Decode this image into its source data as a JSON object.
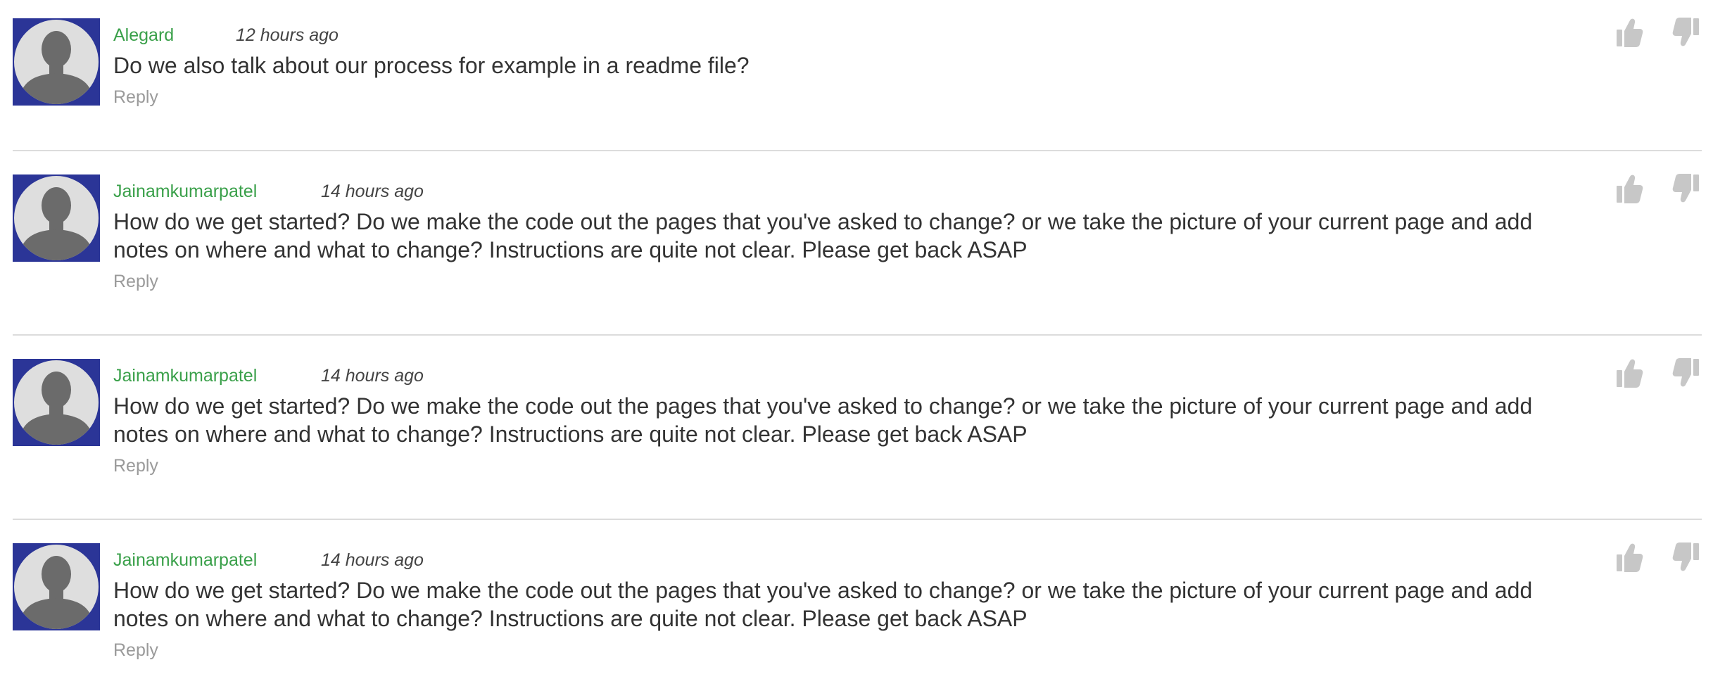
{
  "comments": [
    {
      "author": "Alegard",
      "time": "12 hours ago",
      "text": "Do we also talk about our process for example in a readme file?",
      "reply_label": "Reply"
    },
    {
      "author": "Jainamkumarpatel",
      "time": "14 hours ago",
      "text": "How do we get started? Do we make the code out the pages that you've asked to change? or we take the picture of your current page and add notes on where and what to change? Instructions are quite not clear. Please get back ASAP",
      "reply_label": "Reply"
    },
    {
      "author": "Jainamkumarpatel",
      "time": "14 hours ago",
      "text": "How do we get started? Do we make the code out the pages that you've asked to change? or we take the picture of your current page and add notes on where and what to change? Instructions are quite not clear. Please get back ASAP",
      "reply_label": "Reply"
    },
    {
      "author": "Jainamkumarpatel",
      "time": "14 hours ago",
      "text": "How do we get started? Do we make the code out the pages that you've asked to change? or we take the picture of your current page and add notes on where and what to change? Instructions are quite not clear. Please get back ASAP",
      "reply_label": "Reply"
    }
  ],
  "icons": {
    "avatar": "user-silhouette-icon",
    "like": "thumbs-up-icon",
    "dislike": "thumbs-down-icon"
  },
  "colors": {
    "author": "#3aa04a",
    "avatar_bg": "#2b3597",
    "icon": "#c7c7c7",
    "divider": "#dcdcdc"
  }
}
